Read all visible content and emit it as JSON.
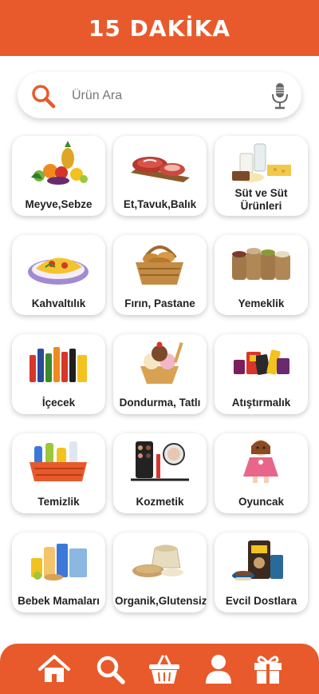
{
  "header": {
    "title": "15 DAKİKA"
  },
  "search": {
    "placeholder": "Ürün Ara",
    "icon": "search-icon",
    "mic_icon": "microphone-icon"
  },
  "categories": [
    {
      "label": "Meyve,Sebze"
    },
    {
      "label": "Et,Tavuk,Balık"
    },
    {
      "label": "Süt ve Süt Ürünleri"
    },
    {
      "label": "Kahvaltılık"
    },
    {
      "label": "Fırın, Pastane"
    },
    {
      "label": "Yemeklik"
    },
    {
      "label": "İçecek"
    },
    {
      "label": "Dondurma, Tatlı"
    },
    {
      "label": "Atıştırmalık"
    },
    {
      "label": "Temizlik"
    },
    {
      "label": "Kozmetik"
    },
    {
      "label": "Oyuncak"
    },
    {
      "label": "Bebek Mamaları"
    },
    {
      "label": "Organik,Glutensiz"
    },
    {
      "label": "Evcil Dostlara"
    }
  ],
  "bottom_nav": [
    "home-icon",
    "search-icon",
    "basket-icon",
    "user-icon",
    "gift-icon"
  ],
  "colors": {
    "accent": "#e85a2b",
    "background": "#ffffff",
    "text": "#222222"
  }
}
